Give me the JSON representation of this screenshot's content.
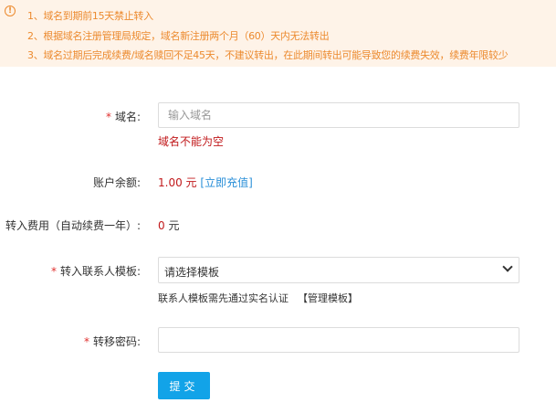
{
  "notice": {
    "icon": "exclamation-circle-icon",
    "color": "#ec8a2e",
    "background": "#fef3e8",
    "lines": [
      "1、域名到期前15天禁止转入",
      "2、根据域名注册管理局规定，域名新注册两个月（60）天内无法转出",
      "3、域名过期后完成续费/域名赎回不足45天，不建议转出，在此期间转出可能导致您的续费失效，续费年限较少"
    ]
  },
  "form": {
    "required_mark": "*",
    "domain": {
      "label": "域名:",
      "placeholder": "输入域名",
      "value": "",
      "error": "域名不能为空"
    },
    "balance": {
      "label": "账户余额:",
      "amount": "1.00",
      "unit": "元",
      "recharge_link": "[立即充值]"
    },
    "transfer_fee": {
      "label": "转入费用（自动续费一年）:",
      "amount": "0",
      "unit": "元"
    },
    "contact_template": {
      "label": "转入联系人模板:",
      "selected": "请选择模板",
      "hint": "联系人模板需先通过实名认证",
      "manage_link": "【管理模板】"
    },
    "transfer_password": {
      "label": "转移密码:",
      "value": ""
    },
    "submit_label": "提交"
  },
  "colors": {
    "accent": "#12a3e8",
    "error": "#c1191b",
    "link": "#2a8fd8",
    "required": "#e0312f"
  }
}
